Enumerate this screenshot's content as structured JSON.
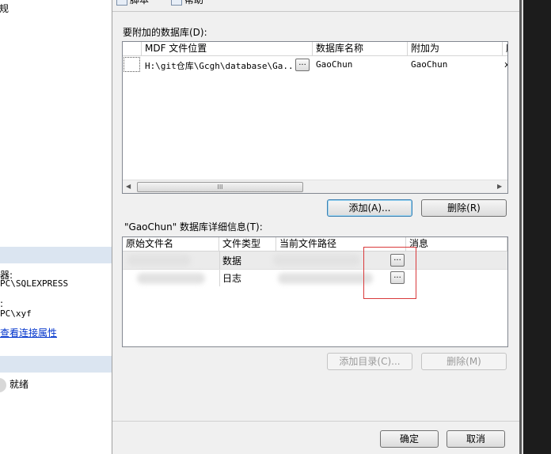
{
  "left": {
    "top_item": "常规",
    "server_label": "器:",
    "server_value": "PC\\SQLEXPRESS",
    "user_label": ":",
    "user_value": "PC\\xyf",
    "view_link": "查看连接属性",
    "status": "就绪"
  },
  "toolbar": {
    "script_label": "脚本",
    "help_label": "帮助"
  },
  "attach": {
    "group_label": "要附加的数据库(D):",
    "columns": [
      "MDF 文件位置",
      "数据库名称",
      "附加为",
      "所"
    ],
    "rows": [
      {
        "mdf": "H:\\git仓库\\Gcgh\\database\\Ga...",
        "browse": "...",
        "db_name": "GaoChun",
        "attach_as": "GaoChun",
        "extra": "x"
      }
    ],
    "scroll_thumb_mark": "III",
    "add_button": "添加(A)...",
    "remove_button": "删除(R)"
  },
  "details": {
    "group_label": "\"GaoChun\" 数据库详细信息(T):",
    "columns": [
      "原始文件名",
      "文件类型",
      "当前文件路径",
      "消息"
    ],
    "rows": [
      {
        "type": "数据",
        "browse": "..."
      },
      {
        "type": "日志",
        "browse": "..."
      }
    ],
    "add_catalog_button": "添加目录(C)...",
    "remove_button": "删除(M)"
  },
  "footer": {
    "ok_button": "确定",
    "cancel_button": "取消"
  },
  "colors": {
    "highlight": "#d9393b",
    "section_header": "#dbe5f1",
    "link": "#0033cc"
  }
}
